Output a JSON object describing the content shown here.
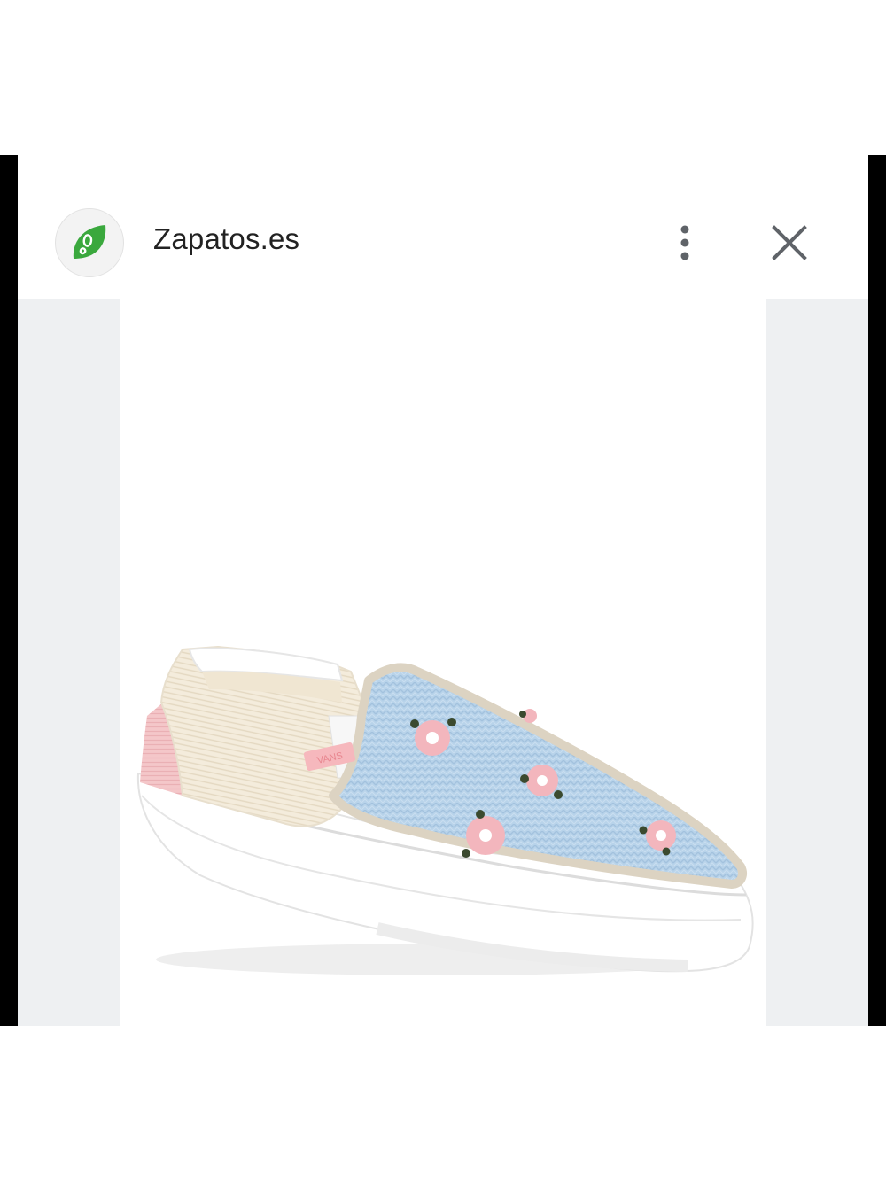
{
  "header": {
    "site_name": "Zapatos.es",
    "logo_icon": "footprint-leaf-icon",
    "menu_icon": "more-vert-icon",
    "close_icon": "close-icon"
  },
  "product": {
    "image": "slip-on-sneaker-floral-knit",
    "brand_tag": "VANS"
  },
  "colors": {
    "logo_green": "#3aa83d",
    "panel_gray": "#eef0f2",
    "knit_blue": "#b8d3ea",
    "flower_pink": "#f3b6bd"
  }
}
